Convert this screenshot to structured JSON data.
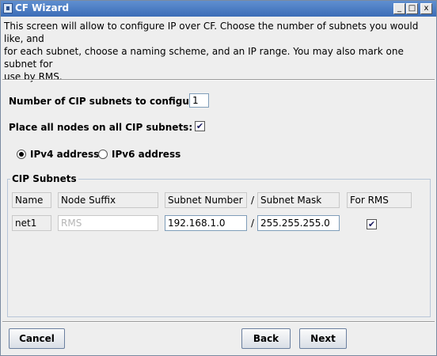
{
  "window": {
    "title": "CF Wizard"
  },
  "titlebar_controls": {
    "minimize": "_",
    "maximize": "□",
    "close": "x"
  },
  "intro": {
    "line1": "This screen will allow to configure IP over CF.  Choose the number of subnets you would like, and",
    "line2": "for each subnet, choose a naming scheme, and an IP range.  You may also mark one subnet for",
    "line3": "use by RMS."
  },
  "settings": {
    "num_subnets_label": "Number of CIP subnets to configure:",
    "num_subnets_value": "1",
    "place_all_label": "Place all nodes on all CIP subnets:",
    "place_all_checked": true,
    "ipv4_label": "IPv4 address",
    "ipv6_label": "IPv6 address",
    "selected_ip_version": "IPv4"
  },
  "cip_subnets": {
    "title": "CIP Subnets",
    "headers": {
      "name": "Name",
      "node_suffix": "Node Suffix",
      "subnet_number": "Subnet Number",
      "separator": "/",
      "subnet_mask": "Subnet Mask",
      "for_rms": "For RMS"
    },
    "rows": [
      {
        "name": "net1",
        "node_suffix": "RMS",
        "subnet_number": "192.168.1.0",
        "separator": "/",
        "subnet_mask": "255.255.255.0",
        "for_rms": true
      }
    ]
  },
  "buttons": {
    "cancel": "Cancel",
    "back": "Back",
    "next": "Next"
  },
  "icons": {
    "checkmark": "✔"
  }
}
